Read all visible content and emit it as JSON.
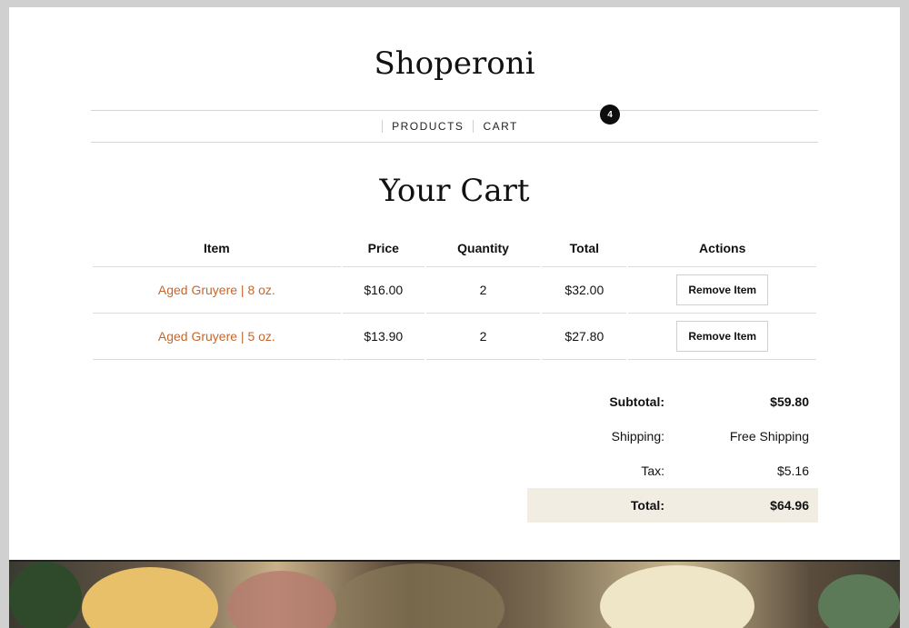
{
  "brand": {
    "name": "Shoperoni"
  },
  "nav": {
    "items": [
      {
        "label": "PRODUCTS"
      },
      {
        "label": "CART"
      }
    ],
    "cart_count": "4"
  },
  "page_title": "Your Cart",
  "cart_table": {
    "headers": [
      "Item",
      "Price",
      "Quantity",
      "Total",
      "Actions"
    ],
    "rows": [
      {
        "item": "Aged Gruyere | 8 oz.",
        "price": "$16.00",
        "quantity": "2",
        "total": "$32.00",
        "action": "Remove Item"
      },
      {
        "item": "Aged Gruyere | 5 oz.",
        "price": "$13.90",
        "quantity": "2",
        "total": "$27.80",
        "action": "Remove Item"
      }
    ]
  },
  "summary": {
    "subtotal_label": "Subtotal:",
    "subtotal_value": "$59.80",
    "shipping_label": "Shipping:",
    "shipping_value": "Free Shipping",
    "tax_label": "Tax:",
    "tax_value": "$5.16",
    "total_label": "Total:",
    "total_value": "$64.96"
  },
  "colors": {
    "accent_link": "#c4672f",
    "total_row_bg": "#f1ede3",
    "badge_bg": "#0d0d0d"
  }
}
